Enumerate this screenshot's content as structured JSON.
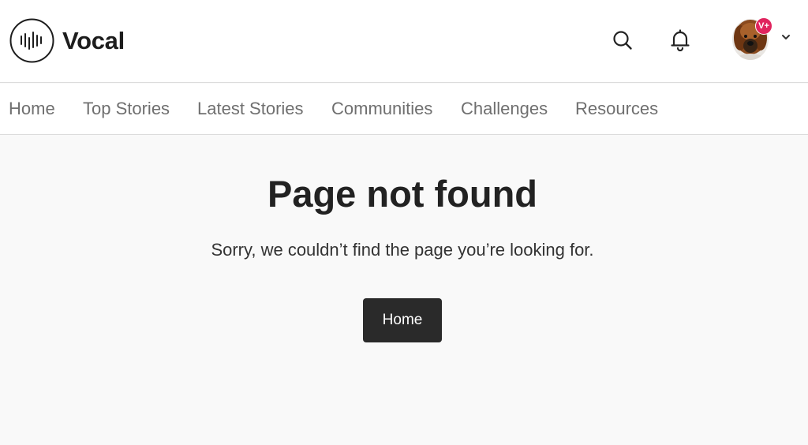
{
  "brand": {
    "name": "Vocal",
    "logo_icon": "vocal-logo-icon"
  },
  "header": {
    "search_icon": "search-icon",
    "notifications_icon": "bell-icon",
    "profile": {
      "badge": "V+",
      "menu_icon": "chevron-down-icon"
    }
  },
  "nav": {
    "items": [
      {
        "label": "Home"
      },
      {
        "label": "Top Stories"
      },
      {
        "label": "Latest Stories"
      },
      {
        "label": "Communities"
      },
      {
        "label": "Challenges"
      },
      {
        "label": "Resources"
      }
    ]
  },
  "main": {
    "title": "Page not found",
    "subtitle": "Sorry, we couldn’t find the page you’re looking for.",
    "home_button": "Home"
  },
  "colors": {
    "background": "#f9f9f9",
    "header_bg": "#ffffff",
    "nav_text": "#6f6f6f",
    "button_bg": "#2a2a2a",
    "badge": "#e0245e"
  }
}
